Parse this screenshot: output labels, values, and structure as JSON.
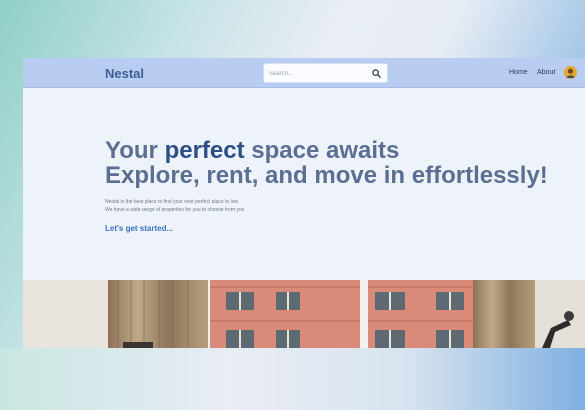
{
  "brand": "Nestal",
  "search": {
    "placeholder": "Search..."
  },
  "nav": {
    "home": "Home",
    "about": "About"
  },
  "hero": {
    "line1_before": "Your ",
    "line1_accent": "perfect",
    "line1_after": " space awaits",
    "line2": "Explore, rent, and move in effortlessly!",
    "desc_line1": "Nestal is the best place to find your next perfect place to live",
    "desc_line2": "We have a wide range of properties for you to choose from you",
    "cta": "Let's get started..."
  },
  "colors": {
    "navbar": "#b9cdf2",
    "brand": "#3f5f93",
    "accent": "#2d4f86",
    "headline": "#5b6f92",
    "cta": "#3a73c4",
    "page_bg": "#eef2fb"
  },
  "icons": {
    "search": "search-icon",
    "avatar": "user-avatar"
  }
}
